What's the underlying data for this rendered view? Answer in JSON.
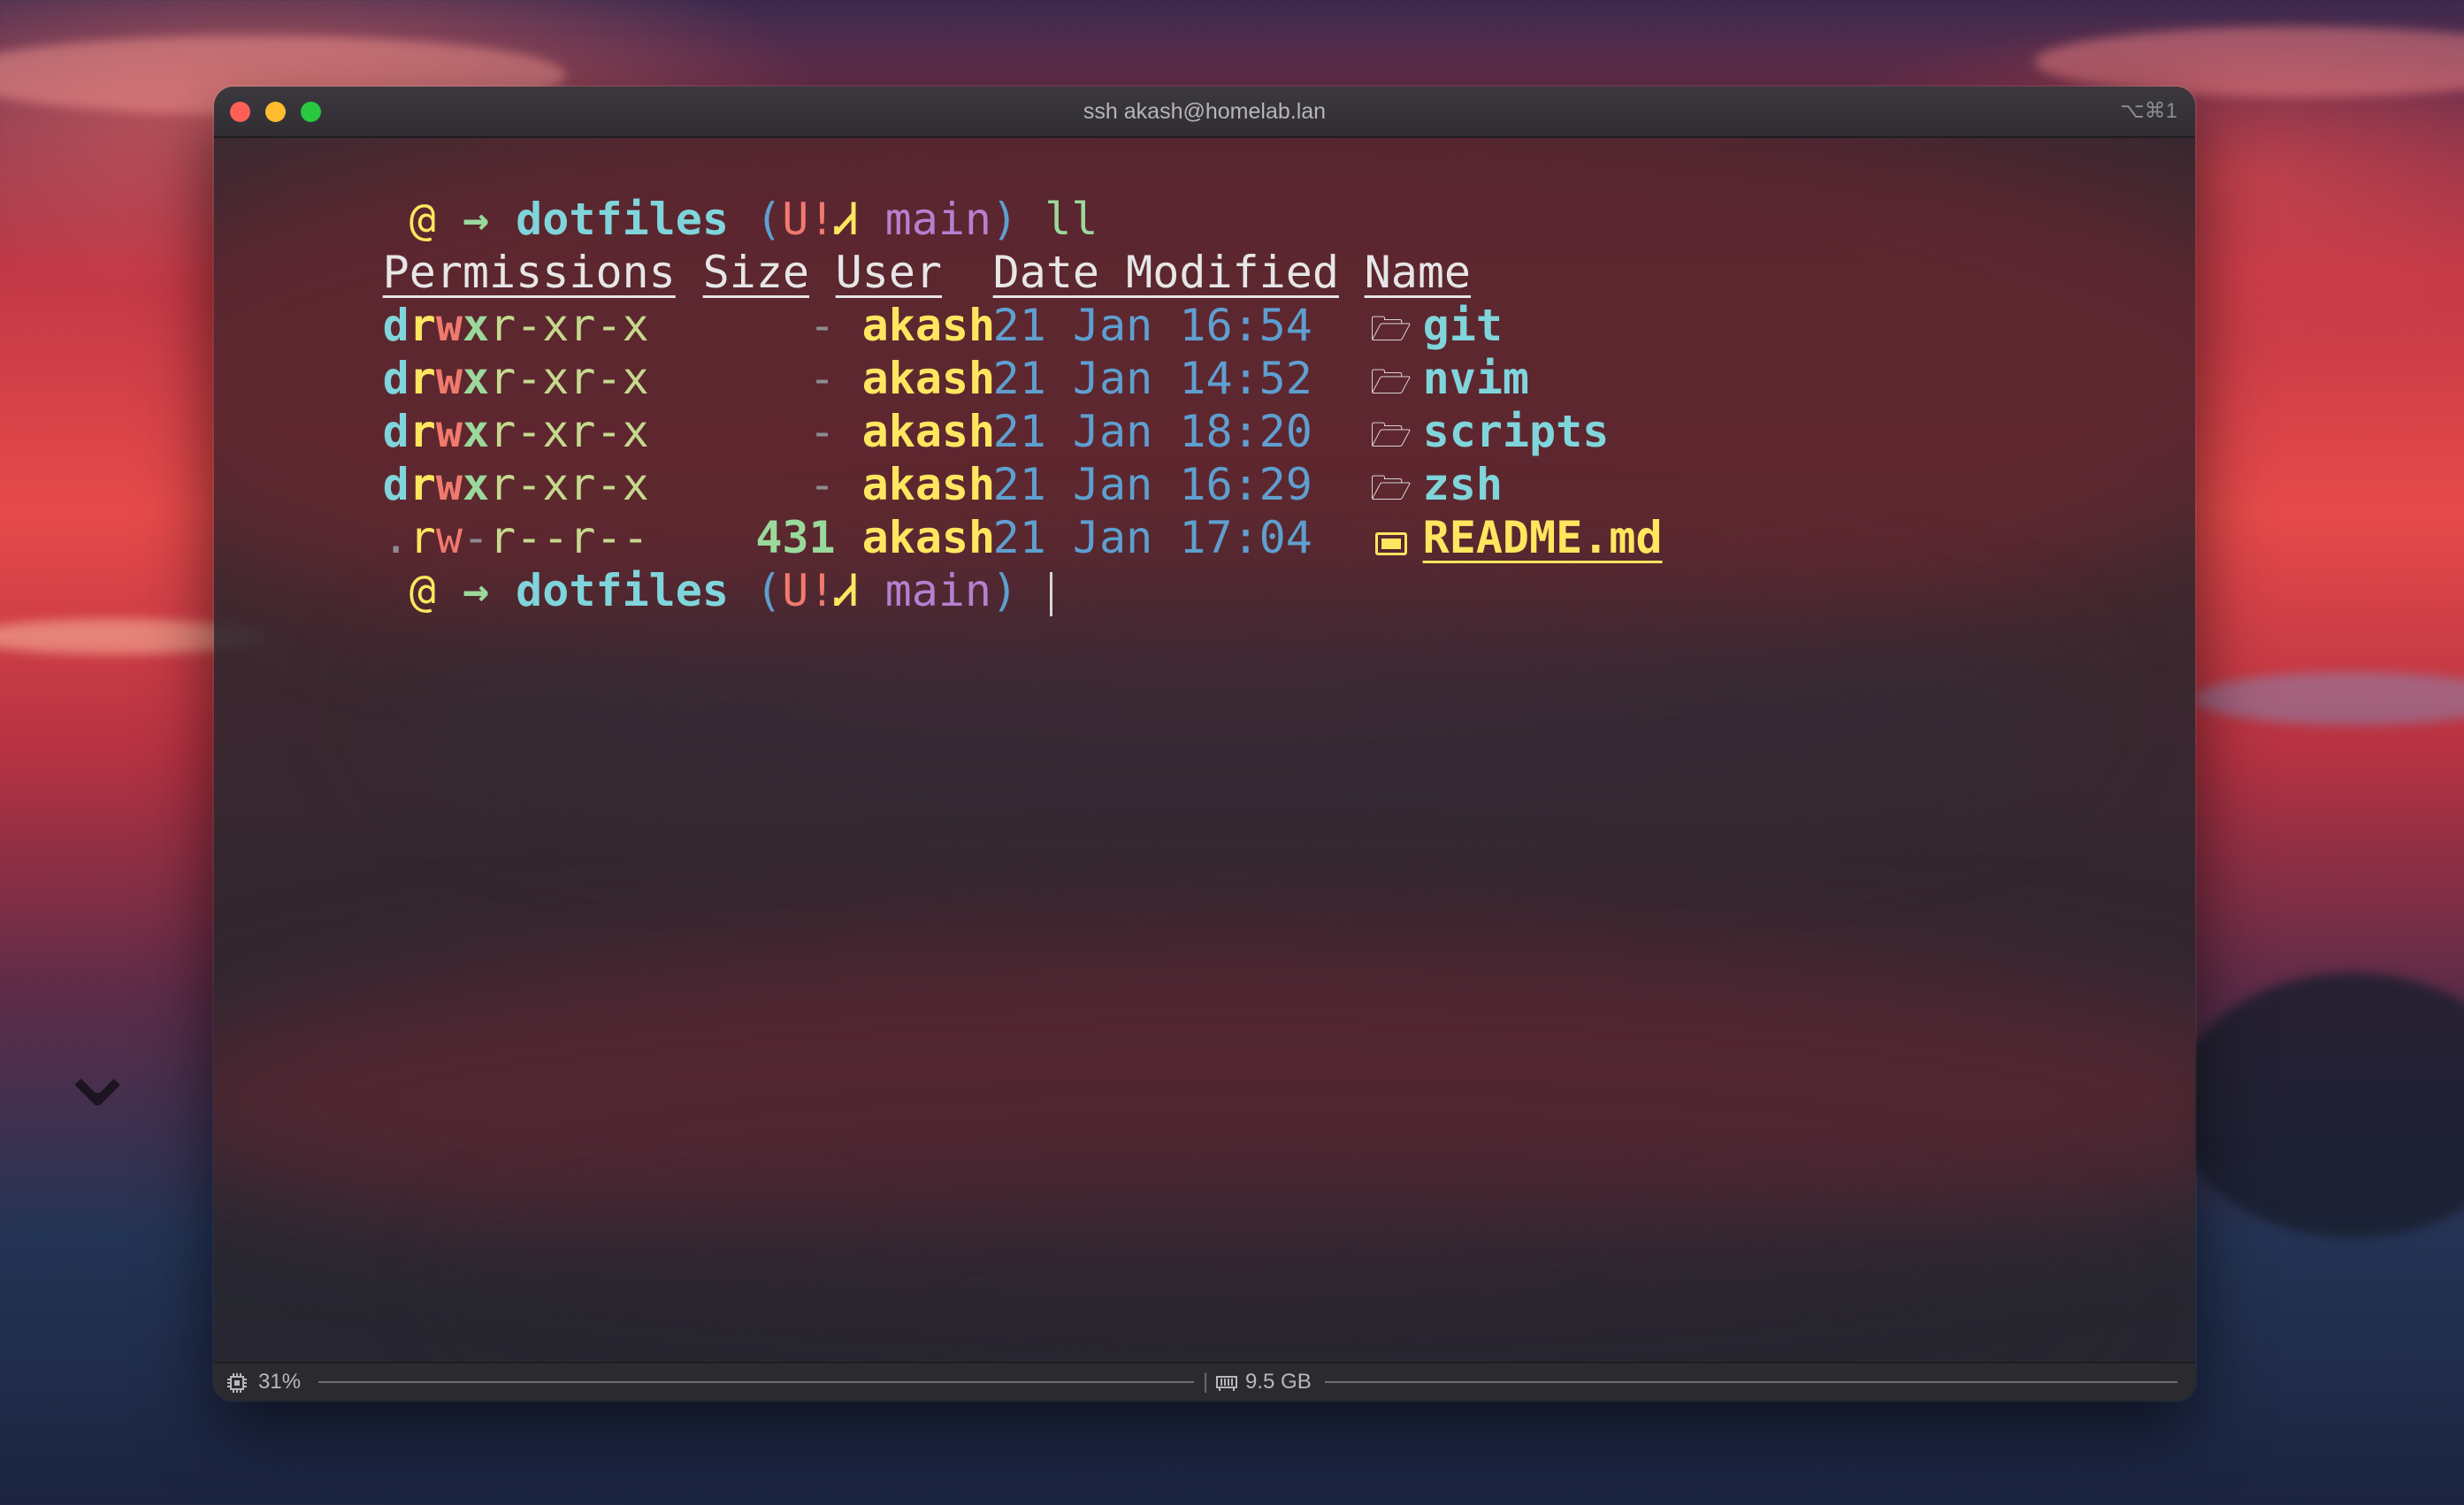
{
  "window": {
    "title": "ssh akash@homelab.lan",
    "shortcut": "⌥⌘1",
    "traffic_lights": {
      "close": "#fe5f57",
      "minimize": "#febc2e",
      "zoom": "#28c840"
    }
  },
  "prompt": {
    "os_icon": "@",
    "arrow": "→",
    "dir": "dotfiles",
    "git_open": "(",
    "git_status": "U!",
    "branch_icon": "Ꮧ",
    "branch": "main",
    "git_close": ")"
  },
  "command": "ll",
  "listing": {
    "headers": {
      "permissions": "Permissions",
      "size": "Size",
      "user": "User",
      "date": "Date Modified",
      "name": "Name"
    },
    "rows": [
      {
        "perm": [
          "d",
          "r",
          "w",
          "x",
          "r-xr-x"
        ],
        "size": "-",
        "user": "akash",
        "date": "21 Jan 16:54",
        "icon": "folder-icon",
        "name": "git"
      },
      {
        "perm": [
          "d",
          "r",
          "w",
          "x",
          "r-xr-x"
        ],
        "size": "-",
        "user": "akash",
        "date": "21 Jan 14:52",
        "icon": "folder-icon",
        "name": "nvim"
      },
      {
        "perm": [
          "d",
          "r",
          "w",
          "x",
          "r-xr-x"
        ],
        "size": "-",
        "user": "akash",
        "date": "21 Jan 18:20",
        "icon": "folder-icon",
        "name": "scripts"
      },
      {
        "perm": [
          "d",
          "r",
          "w",
          "x",
          "r-xr-x"
        ],
        "size": "-",
        "user": "akash",
        "date": "21 Jan 16:29",
        "icon": "folder-icon",
        "name": "zsh"
      },
      {
        "perm": [
          ".",
          "r",
          "w",
          "-",
          "r--r--"
        ],
        "size": "431",
        "user": "akash",
        "date": "21 Jan 17:04",
        "icon": "markdown-icon",
        "name": "README.md"
      }
    ]
  },
  "status": {
    "cpu_icon": "cpu-icon",
    "cpu": "31%",
    "mem_icon": "memory-icon",
    "memory": "9.5 GB"
  },
  "colors": {
    "cyan": "#7fd5db",
    "green": "#9ad99c",
    "yellow": "#ffe65f",
    "red": "#f07a6d",
    "purple": "#b67fd0",
    "blue": "#5e9fd0",
    "white": "#e6e6e6",
    "gray": "#8e8c92"
  }
}
